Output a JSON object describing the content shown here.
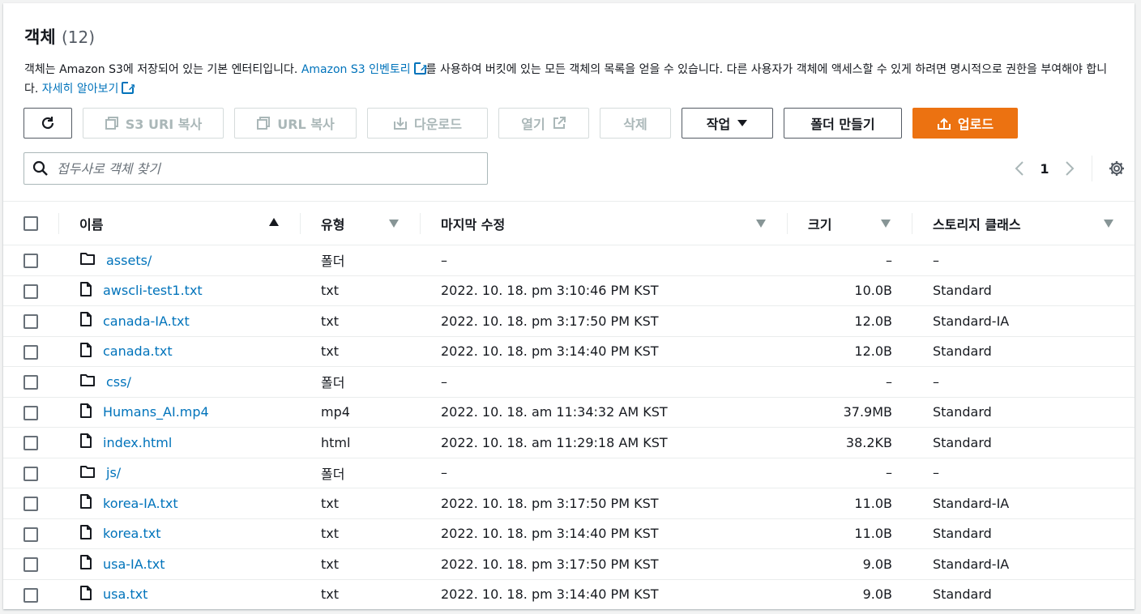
{
  "header": {
    "title": "객체",
    "count": "(12)",
    "desc_part1": "객체는 Amazon S3에 저장되어 있는 기본 엔터티입니다. ",
    "desc_link1": "Amazon S3 인벤토리",
    "desc_part2": "를 사용하여 버킷에 있는 모든 객체의 목록을 얻을 수 있습니다. 다른 사용자가 객체에 액세스할 수 있게 하려면 명시적으로 권한을 부여해야 합니다. ",
    "desc_link2": "자세히 알아보기"
  },
  "toolbar": {
    "copy_s3_uri": "S3 URI 복사",
    "copy_url": "URL 복사",
    "download": "다운로드",
    "open": "열기",
    "delete": "삭제",
    "actions": "작업",
    "create_folder": "폴더 만들기",
    "upload": "업로드"
  },
  "search": {
    "placeholder": "접두사로 객체 찾기"
  },
  "pager": {
    "current": "1"
  },
  "columns": {
    "name": "이름",
    "type": "유형",
    "modified": "마지막 수정",
    "size": "크기",
    "storage": "스토리지 클래스"
  },
  "rows": [
    {
      "name": "assets/",
      "kind": "folder",
      "type": "폴더",
      "modified": "–",
      "size": "–",
      "storage": "–"
    },
    {
      "name": "awscli-test1.txt",
      "kind": "file",
      "type": "txt",
      "modified": "2022. 10. 18. pm 3:10:46 PM KST",
      "size": "10.0B",
      "storage": "Standard"
    },
    {
      "name": "canada-IA.txt",
      "kind": "file",
      "type": "txt",
      "modified": "2022. 10. 18. pm 3:17:50 PM KST",
      "size": "12.0B",
      "storage": "Standard-IA"
    },
    {
      "name": "canada.txt",
      "kind": "file",
      "type": "txt",
      "modified": "2022. 10. 18. pm 3:14:40 PM KST",
      "size": "12.0B",
      "storage": "Standard"
    },
    {
      "name": "css/",
      "kind": "folder",
      "type": "폴더",
      "modified": "–",
      "size": "–",
      "storage": "–"
    },
    {
      "name": "Humans_AI.mp4",
      "kind": "file",
      "type": "mp4",
      "modified": "2022. 10. 18. am 11:34:32 AM KST",
      "size": "37.9MB",
      "storage": "Standard"
    },
    {
      "name": "index.html",
      "kind": "file",
      "type": "html",
      "modified": "2022. 10. 18. am 11:29:18 AM KST",
      "size": "38.2KB",
      "storage": "Standard"
    },
    {
      "name": "js/",
      "kind": "folder",
      "type": "폴더",
      "modified": "–",
      "size": "–",
      "storage": "–"
    },
    {
      "name": "korea-IA.txt",
      "kind": "file",
      "type": "txt",
      "modified": "2022. 10. 18. pm 3:17:50 PM KST",
      "size": "11.0B",
      "storage": "Standard-IA"
    },
    {
      "name": "korea.txt",
      "kind": "file",
      "type": "txt",
      "modified": "2022. 10. 18. pm 3:14:40 PM KST",
      "size": "11.0B",
      "storage": "Standard"
    },
    {
      "name": "usa-IA.txt",
      "kind": "file",
      "type": "txt",
      "modified": "2022. 10. 18. pm 3:17:50 PM KST",
      "size": "9.0B",
      "storage": "Standard-IA"
    },
    {
      "name": "usa.txt",
      "kind": "file",
      "type": "txt",
      "modified": "2022. 10. 18. pm 3:14:40 PM KST",
      "size": "9.0B",
      "storage": "Standard"
    }
  ],
  "colors": {
    "link": "#0073bb",
    "primary": "#ec7211"
  }
}
